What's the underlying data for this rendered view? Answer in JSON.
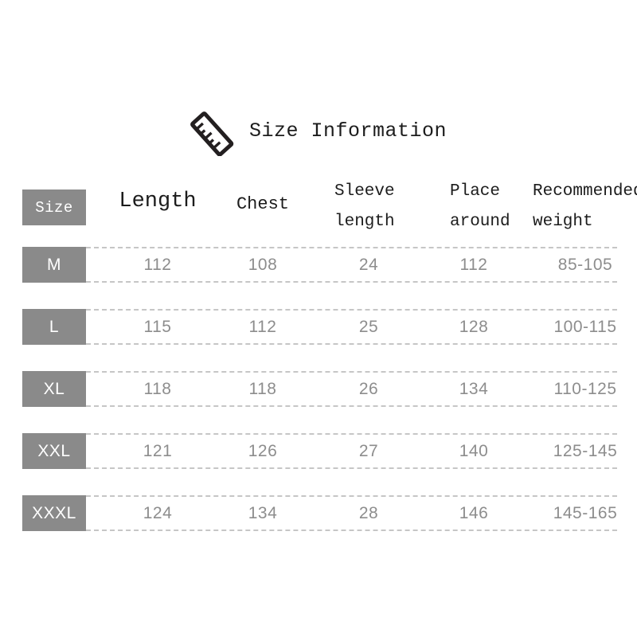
{
  "header": {
    "title": "Size Information",
    "icon": "ruler-icon"
  },
  "colors": {
    "chip_background": "#8a8a8a",
    "chip_text": "#ffffff",
    "data_text": "#8d8d8d",
    "header_text": "#1c1c1c",
    "dashed_rule": "#c6c6c6",
    "page_background": "#ffffff"
  },
  "table": {
    "columns": [
      {
        "key": "size",
        "label": "Size",
        "label_line1": "Size",
        "label_line2": ""
      },
      {
        "key": "length",
        "label": "Length",
        "label_line1": "Length",
        "label_line2": ""
      },
      {
        "key": "chest",
        "label": "Chest",
        "label_line1": "Chest",
        "label_line2": ""
      },
      {
        "key": "sleeve",
        "label": "Sleeve length",
        "label_line1": "Sleeve",
        "label_line2": "length"
      },
      {
        "key": "place",
        "label": "Place around",
        "label_line1": "Place",
        "label_line2": "around"
      },
      {
        "key": "weight",
        "label": "Recommended weight",
        "label_line1": "Recommended",
        "label_line2": "weight"
      }
    ],
    "rows": [
      {
        "size": "M",
        "length": "112",
        "chest": "108",
        "sleeve": "24",
        "place": "112",
        "weight": "85-105"
      },
      {
        "size": "L",
        "length": "115",
        "chest": "112",
        "sleeve": "25",
        "place": "128",
        "weight": "100-115"
      },
      {
        "size": "XL",
        "length": "118",
        "chest": "118",
        "sleeve": "26",
        "place": "134",
        "weight": "110-125"
      },
      {
        "size": "XXL",
        "length": "121",
        "chest": "126",
        "sleeve": "27",
        "place": "140",
        "weight": "125-145"
      },
      {
        "size": "XXXL",
        "length": "124",
        "chest": "134",
        "sleeve": "28",
        "place": "146",
        "weight": "145-165"
      }
    ]
  }
}
